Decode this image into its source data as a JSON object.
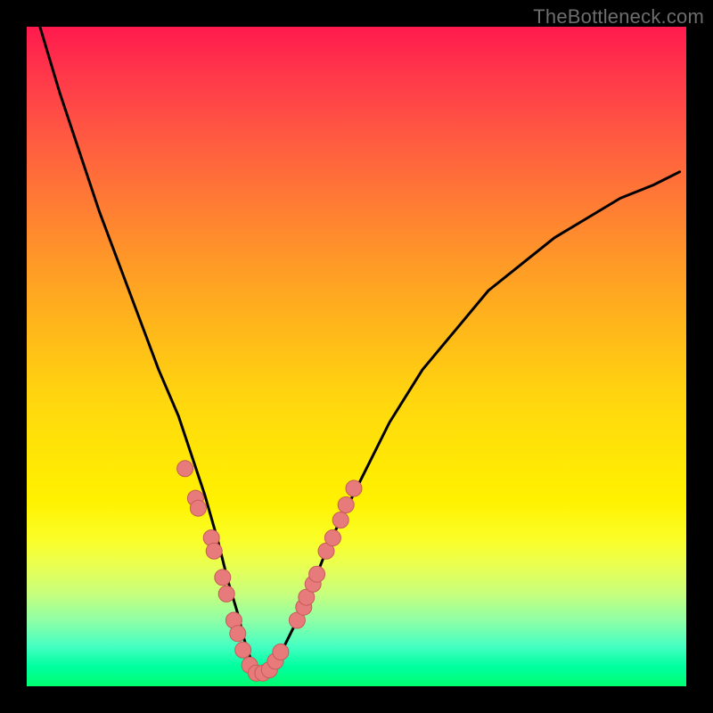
{
  "watermark": "TheBottleneck.com",
  "chart_data": {
    "type": "line",
    "title": "",
    "xlabel": "",
    "ylabel": "",
    "xlim": [
      0,
      100
    ],
    "ylim": [
      0,
      100
    ],
    "series": [
      {
        "name": "curve",
        "x": [
          2,
          5,
          8,
          11,
          14,
          17,
          20,
          23,
          25,
          27,
          29,
          30.5,
          32,
          33,
          34,
          35,
          36,
          38,
          40,
          42,
          44,
          46,
          48,
          51,
          55,
          60,
          65,
          70,
          75,
          80,
          85,
          90,
          95,
          99
        ],
        "y": [
          100,
          90,
          81,
          72,
          64,
          56,
          48,
          41,
          35,
          29,
          22,
          16,
          11,
          7,
          4,
          2,
          2,
          4,
          8,
          12,
          17,
          22,
          26,
          32,
          40,
          48,
          54,
          60,
          64,
          68,
          71,
          74,
          76,
          78
        ]
      }
    ],
    "markers": [
      {
        "x": 24.0,
        "y": 33.0
      },
      {
        "x": 25.6,
        "y": 28.5
      },
      {
        "x": 26.0,
        "y": 27.0
      },
      {
        "x": 28.0,
        "y": 22.5
      },
      {
        "x": 28.4,
        "y": 20.5
      },
      {
        "x": 29.7,
        "y": 16.5
      },
      {
        "x": 30.3,
        "y": 14.0
      },
      {
        "x": 31.4,
        "y": 10.0
      },
      {
        "x": 32.0,
        "y": 8.0
      },
      {
        "x": 32.8,
        "y": 5.5
      },
      {
        "x": 33.8,
        "y": 3.2
      },
      {
        "x": 34.8,
        "y": 2.0
      },
      {
        "x": 35.8,
        "y": 2.0
      },
      {
        "x": 36.8,
        "y": 2.5
      },
      {
        "x": 37.7,
        "y": 3.8
      },
      {
        "x": 38.5,
        "y": 5.2
      },
      {
        "x": 41.0,
        "y": 10.0
      },
      {
        "x": 42.0,
        "y": 12.0
      },
      {
        "x": 42.4,
        "y": 13.5
      },
      {
        "x": 43.4,
        "y": 15.5
      },
      {
        "x": 44.0,
        "y": 17.0
      },
      {
        "x": 45.4,
        "y": 20.5
      },
      {
        "x": 46.4,
        "y": 22.5
      },
      {
        "x": 47.6,
        "y": 25.2
      },
      {
        "x": 48.4,
        "y": 27.5
      },
      {
        "x": 49.6,
        "y": 30.0
      }
    ],
    "marker_style": {
      "fill": "#e77a7a",
      "stroke": "#c85a5a",
      "radius_px": 9
    },
    "background_gradient": {
      "top": "#ff1a4d",
      "bottom": "#00ff70"
    }
  }
}
